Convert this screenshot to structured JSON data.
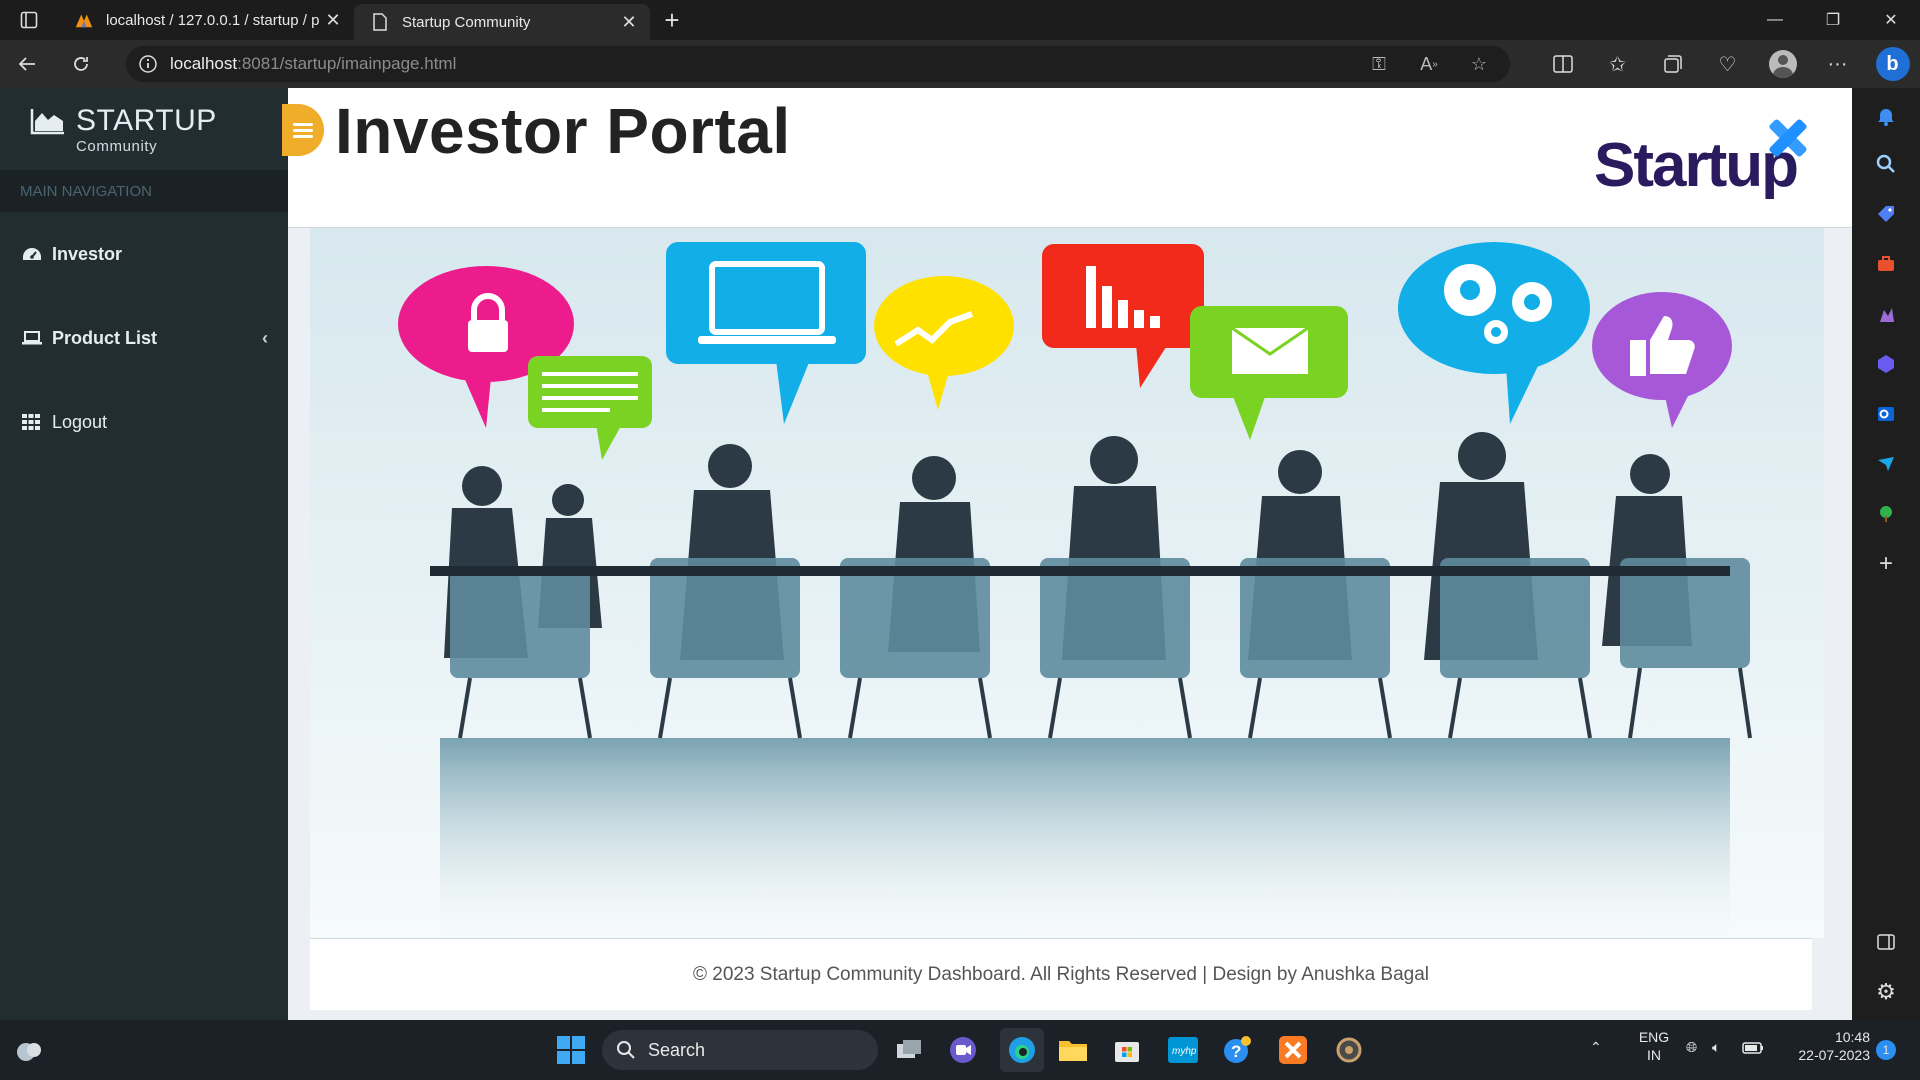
{
  "browser": {
    "tabs": [
      {
        "title": "localhost / 127.0.0.1 / startup / p",
        "active": false
      },
      {
        "title": "Startup Community",
        "active": true
      }
    ],
    "url_host": "localhost",
    "url_rest": ":8081/startup/imainpage.html"
  },
  "sidebar": {
    "brand_title": "STARTUP",
    "brand_subtitle": "Community",
    "nav_header": "MAIN NAVIGATION",
    "items": [
      {
        "label": "Investor",
        "icon": "dashboard-icon"
      },
      {
        "label": "Product List",
        "icon": "laptop-icon"
      },
      {
        "label": "Logout",
        "icon": "grid-icon"
      }
    ]
  },
  "header": {
    "title": "Investor Portal",
    "logo_text": "Startup"
  },
  "footer": {
    "text": "© 2023 Startup Community Dashboard. All Rights Reserved | Design by Anushka Bagal"
  },
  "taskbar": {
    "search_placeholder": "Search",
    "language": "ENG",
    "region": "IN",
    "time": "10:48",
    "date": "22-07-2023",
    "notification_count": "1"
  },
  "colors": {
    "sidebar_bg": "#222d32",
    "toggle": "#f0ad29",
    "logo_navy": "#2a1a5e",
    "logo_x": "#1e90ff"
  }
}
